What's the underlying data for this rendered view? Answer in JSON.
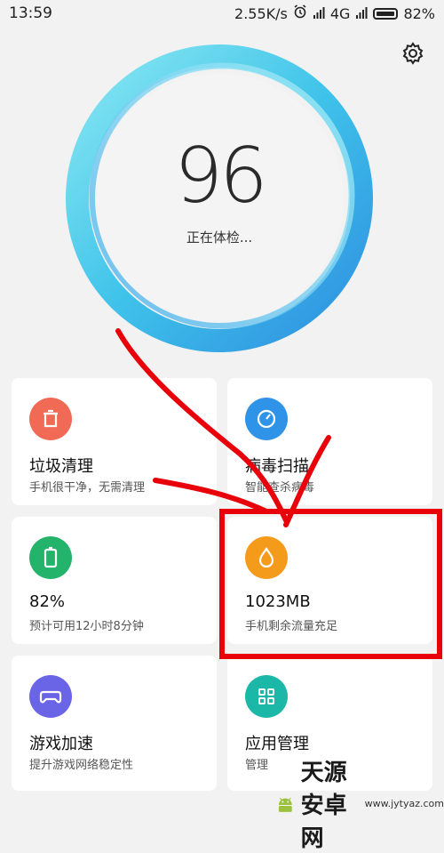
{
  "status_bar": {
    "time": "13:59",
    "speed": "2.55K/s",
    "network": "4G",
    "battery": "82%"
  },
  "header": {
    "settings_icon": "gear-icon"
  },
  "score": {
    "value": "96",
    "status": "正在体检..."
  },
  "cards": [
    {
      "title": "垃圾清理",
      "subtitle": "手机很干净，无需清理",
      "icon": "trash-icon",
      "color": "#f16a55"
    },
    {
      "title": "病毒扫描",
      "subtitle": "智能查杀病毒",
      "icon": "gauge-icon",
      "color": "#2f93e8"
    },
    {
      "title": "82%",
      "subtitle": "预计可用12小时8分钟",
      "icon": "battery-icon",
      "color": "#23b36a"
    },
    {
      "title": "1023MB",
      "subtitle": "手机剩余流量充足",
      "icon": "drop-icon",
      "color": "#f59b1c"
    },
    {
      "title": "游戏加速",
      "subtitle": "提升游戏网络稳定性",
      "icon": "gamepad-icon",
      "color": "#6a64e6"
    },
    {
      "title": "应用管理",
      "subtitle": "管理",
      "icon": "grid-icon",
      "color": "#1bb8a8"
    }
  ],
  "watermark": {
    "title": "天源安卓网",
    "url": "www.jytyaz.com"
  },
  "colors": {
    "annotation": "#e8000a",
    "ring_start": "#7fe4f0",
    "ring_end": "#2e8fe0"
  }
}
